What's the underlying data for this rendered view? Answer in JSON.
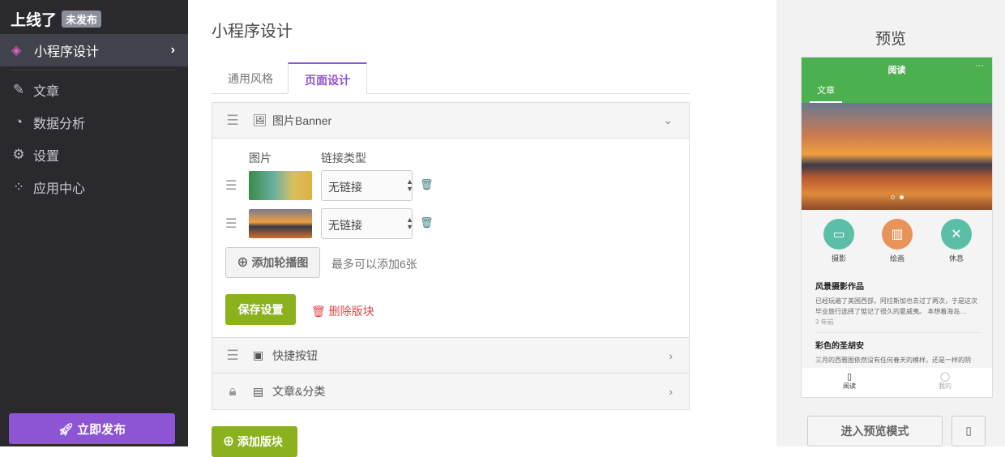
{
  "sidebar": {
    "brand": "上线了",
    "status_badge": "未发布",
    "active_item": "小程序设计",
    "items": [
      {
        "label": "文章",
        "icon": "feather-icon"
      },
      {
        "label": "数据分析",
        "icon": "pie-chart-icon"
      },
      {
        "label": "设置",
        "icon": "gear-icon"
      },
      {
        "label": "应用中心",
        "icon": "grid-icon"
      }
    ],
    "publish_label": "立即发布"
  },
  "main": {
    "title": "小程序设计",
    "tabs": [
      {
        "label": "通用风格"
      },
      {
        "label": "页面设计"
      }
    ],
    "blocks": [
      {
        "title": "图片Banner"
      },
      {
        "title": "快捷按钮"
      },
      {
        "title": "文章&分类"
      }
    ],
    "banner": {
      "col_image": "图片",
      "col_link": "链接类型",
      "rows": [
        {
          "link": "无链接"
        },
        {
          "link": "无链接"
        }
      ],
      "add_label": "添加轮播图",
      "hint": "最多可以添加6张",
      "save_label": "保存设置",
      "delete_label": "删除版块"
    },
    "add_block_label": "添加版块"
  },
  "preview": {
    "title": "预览",
    "phone": {
      "nav_title": "阅读",
      "more": "···",
      "tab": "文章",
      "quick": [
        {
          "label": "摄影",
          "color": "#5bbfa8"
        },
        {
          "label": "绘画",
          "color": "#e8935a"
        },
        {
          "label": "休息",
          "color": "#5bbfa8"
        }
      ],
      "articles": [
        {
          "title": "风景摄影作品",
          "text": "已经玩遍了美国西部，阿拉斯加也去过了两次，于是这次毕业旅行选择了惦记了很久的夏威夷。 本想着海岛…",
          "time": "3 年前"
        },
        {
          "title": "彩色的圣胡安",
          "text": "三月的西雅图依然没有任何春天的模样，还是一样的阴"
        }
      ],
      "bottom_tabs": [
        {
          "label": "阅读"
        },
        {
          "label": "我的"
        }
      ]
    },
    "enter_label": "进入预览模式"
  },
  "colors": {
    "accent": "#8d55d4",
    "green": "#8bb21c",
    "phone_green": "#4caf50",
    "danger": "#e04848"
  }
}
